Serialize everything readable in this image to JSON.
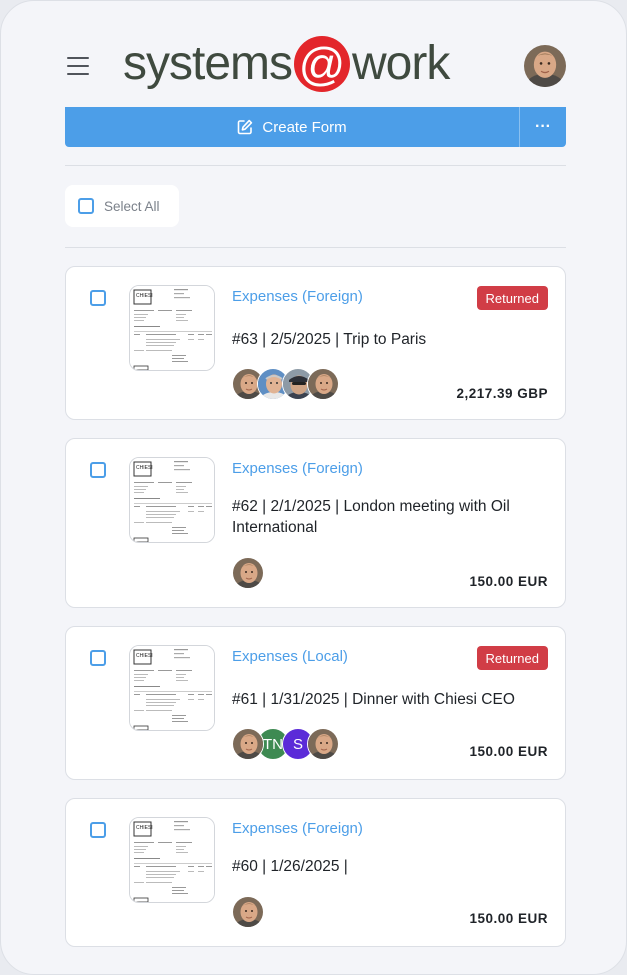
{
  "header": {
    "logo_left": "systems",
    "logo_at": "@",
    "logo_right": "work"
  },
  "toolbar": {
    "create_label": "Create Form",
    "more_label": "···"
  },
  "select_all": {
    "label": "Select All"
  },
  "forms": [
    {
      "type": "Expenses (Foreign)",
      "status": "Returned",
      "title": "#63 | 2/5/2025 | Trip to Paris",
      "amount": "2,217.39 GBP"
    },
    {
      "type": "Expenses (Foreign)",
      "status": "",
      "title": "#62 | 2/1/2025 | London meeting with Oil International",
      "amount": "150.00 EUR"
    },
    {
      "type": "Expenses (Local)",
      "status": "Returned",
      "title": "#61 | 1/31/2025 | Dinner with Chiesi CEO",
      "amount": "150.00 EUR",
      "initials": [
        "TN",
        "S"
      ]
    },
    {
      "type": "Expenses (Foreign)",
      "status": "",
      "title": "#60 | 1/26/2025 |",
      "amount": "150.00 EUR"
    }
  ],
  "colors": {
    "accent": "#4c9ee8",
    "returned_badge": "#d13d46",
    "logo_at": "#e3262b",
    "initial_tn": "#3e8a52",
    "initial_s": "#5b2bd8"
  },
  "icons": {
    "menu": "hamburger-icon",
    "create": "edit-icon",
    "more": "more-horizontal-icon"
  }
}
